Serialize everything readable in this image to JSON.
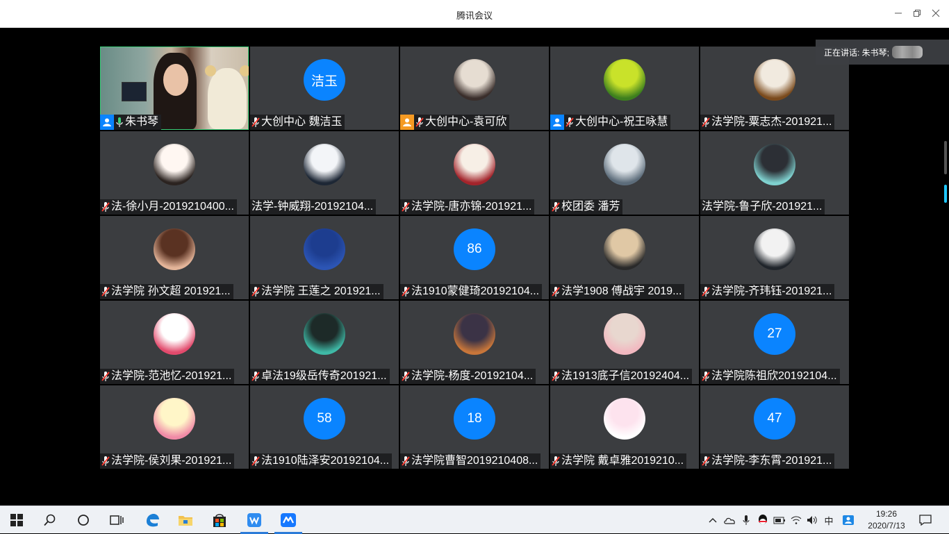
{
  "window": {
    "title": "腾讯会议",
    "minimize_icon": "minimize-icon",
    "maximize_icon": "restore-icon",
    "close_icon": "close-icon"
  },
  "speaking": {
    "label": "正在讲话: 朱书琴;"
  },
  "colors": {
    "accent": "#0a84ff",
    "host_orange": "#f59a23",
    "active_border": "#3cd07a",
    "tile_bg": "#3b3d40"
  },
  "participants": [
    {
      "name": "朱书琴",
      "type": "video",
      "badge": "blue",
      "mic": "on"
    },
    {
      "name": "大创中心 魏洁玉",
      "type": "text",
      "avatar_text": "洁玉",
      "mic": "off"
    },
    {
      "name": "大创中心-袁可欣",
      "type": "image",
      "badge": "orange",
      "mic": "off",
      "swatch": [
        "#e6ddd2",
        "#3a2e2b"
      ]
    },
    {
      "name": "大创中心-祝王咏慧",
      "type": "image",
      "badge": "blue",
      "mic": "off",
      "swatch": [
        "#c9e22a",
        "#3d7f1e"
      ]
    },
    {
      "name": "法学院-粟志杰-201921...",
      "type": "image",
      "mic": "off",
      "swatch": [
        "#f1eadf",
        "#7a4a1c"
      ]
    },
    {
      "name": "法-徐小月-2019210400...",
      "type": "image",
      "mic": "off",
      "swatch": [
        "#fff7f2",
        "#2b2320"
      ]
    },
    {
      "name": "法学-钟威翔-20192104...",
      "type": "image",
      "mic": "none",
      "swatch": [
        "#f3f5f8",
        "#1d2735"
      ]
    },
    {
      "name": "法学院-唐亦锦-201921...",
      "type": "image",
      "mic": "off",
      "swatch": [
        "#f7efe6",
        "#a3242b"
      ]
    },
    {
      "name": "校团委 潘芳",
      "type": "image",
      "mic": "off",
      "swatch": [
        "#dfe5ea",
        "#5c6c7a"
      ]
    },
    {
      "name": "法学院-鲁子欣-201921...",
      "type": "image",
      "mic": "none",
      "swatch": [
        "#2c2f35",
        "#7fd1cf"
      ]
    },
    {
      "name": "法学院 孙文超 201921...",
      "type": "image",
      "mic": "off",
      "swatch": [
        "#5a3222",
        "#e3b499"
      ]
    },
    {
      "name": "法学院 王莲之 201921...",
      "type": "image",
      "mic": "off",
      "swatch": [
        "#1d3d8f",
        "#2c55b5"
      ]
    },
    {
      "name": "法1910蒙健琦20192104...",
      "type": "number",
      "avatar_text": "86",
      "mic": "off"
    },
    {
      "name": "法学1908 傅战宇 2019...",
      "type": "image",
      "mic": "off",
      "swatch": [
        "#e0c8a5",
        "#2a2a2a"
      ]
    },
    {
      "name": "法学院-齐玮钰-201921...",
      "type": "image",
      "mic": "off",
      "swatch": [
        "#f2f2f2",
        "#20252b"
      ]
    },
    {
      "name": "法学院-范池忆-201921...",
      "type": "image",
      "mic": "off",
      "swatch": [
        "#ffffff",
        "#e24a6c"
      ]
    },
    {
      "name": "卓法19级岳传奇201921...",
      "type": "image",
      "mic": "off",
      "swatch": [
        "#1d2a28",
        "#3fb9a6"
      ]
    },
    {
      "name": "法学院-杨度-20192104...",
      "type": "image",
      "mic": "off",
      "swatch": [
        "#3b3346",
        "#c8763a"
      ]
    },
    {
      "name": "法1913底子信20192404...",
      "type": "image",
      "mic": "off",
      "swatch": [
        "#e8d7cf",
        "#f2b8c0"
      ]
    },
    {
      "name": "法学院陈祖欣20192104...",
      "type": "number",
      "avatar_text": "27",
      "mic": "off"
    },
    {
      "name": "法学院-侯刘果-201921...",
      "type": "image",
      "mic": "off",
      "swatch": [
        "#fff6c8",
        "#f08aa6"
      ]
    },
    {
      "name": "法1910陆泽安20192104...",
      "type": "number",
      "avatar_text": "58",
      "mic": "off"
    },
    {
      "name": "法学院曹智2019210408...",
      "type": "number",
      "avatar_text": "18",
      "mic": "off"
    },
    {
      "name": "法学院 戴卓雅2019210...",
      "type": "image",
      "mic": "off",
      "swatch": [
        "#fde3ee",
        "#ffffff"
      ]
    },
    {
      "name": "法学院-李东霄-201921...",
      "type": "number",
      "avatar_text": "47",
      "mic": "off"
    }
  ],
  "taskbar": {
    "items": [
      {
        "icon": "windows-start-icon"
      },
      {
        "icon": "search-icon"
      },
      {
        "icon": "cortana-icon"
      },
      {
        "icon": "task-view-icon"
      },
      {
        "icon": "edge-icon"
      },
      {
        "icon": "file-explorer-icon"
      },
      {
        "icon": "store-icon"
      },
      {
        "icon": "wps-icon",
        "active": true
      },
      {
        "icon": "tencent-meeting-icon",
        "active": true
      }
    ],
    "tray": [
      "chevron-up-icon",
      "onedrive-icon",
      "microphone-icon",
      "qq-icon",
      "battery-icon",
      "wifi-icon",
      "volume-icon",
      "ime-icon",
      "contact-icon"
    ],
    "ime_label": "中",
    "time": "19:26",
    "date": "2020/7/13",
    "notification_icon": "notification-icon"
  }
}
